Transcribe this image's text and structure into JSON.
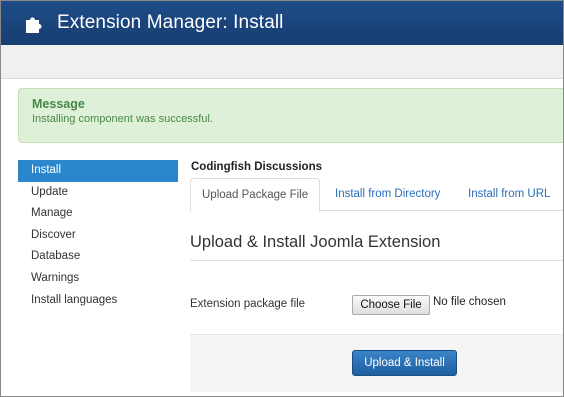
{
  "header": {
    "title": "Extension Manager: Install",
    "icon": "puzzle-icon",
    "background": "#1f4d88"
  },
  "message": {
    "heading": "Message",
    "text": "Installing component was successful.",
    "color": "#468847",
    "background": "#dff0d8"
  },
  "sidebar": {
    "active_color": "#2a87cc",
    "items": [
      {
        "label": "Install"
      },
      {
        "label": "Update"
      },
      {
        "label": "Manage"
      },
      {
        "label": "Discover"
      },
      {
        "label": "Database"
      },
      {
        "label": "Warnings"
      },
      {
        "label": "Install languages"
      }
    ]
  },
  "main": {
    "section_label": "Codingfish Discussions",
    "tabs": [
      {
        "label": "Upload Package File"
      },
      {
        "label": "Install from Directory"
      },
      {
        "label": "Install from URL"
      }
    ],
    "heading": "Upload & Install Joomla Extension",
    "file_label": "Extension package file",
    "choose_button": "Choose File",
    "no_file_text": "No file chosen",
    "submit_button": "Upload & Install"
  }
}
